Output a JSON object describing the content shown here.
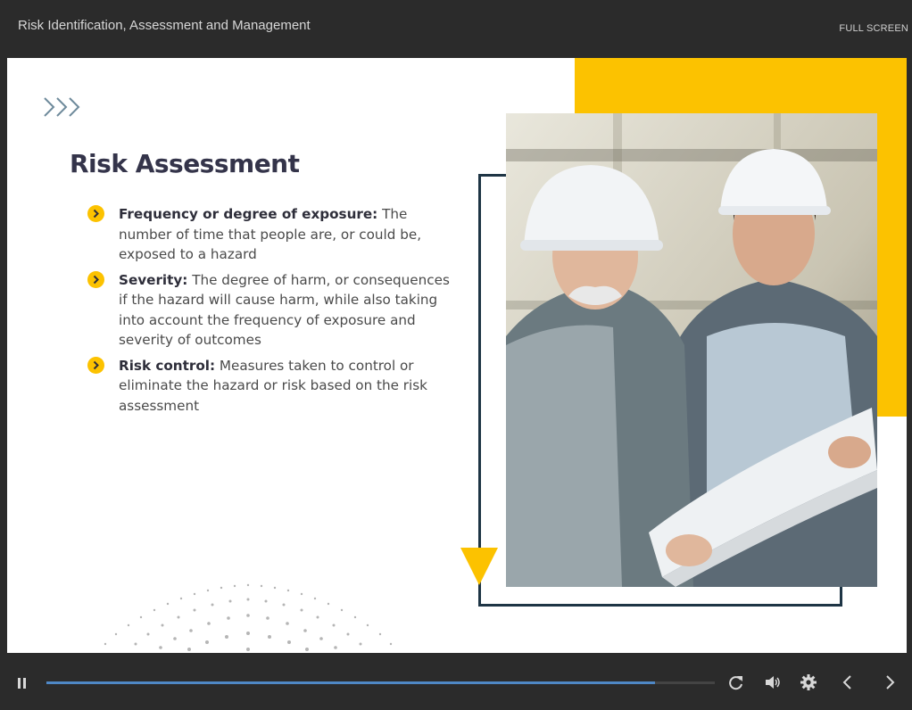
{
  "header": {
    "course_title": "Risk Identification, Assessment and Management",
    "fullscreen_label": "FULL SCREEN"
  },
  "slide": {
    "heading": "Risk Assessment",
    "bullets": [
      {
        "term": "Frequency or degree of exposure:",
        "text": " The number of time that people are, or could be, exposed to a hazard"
      },
      {
        "term": "Severity:",
        "text": " The degree of harm, or consequences if the hazard will cause harm, while also taking into account the frequency of exposure and severity of outcomes"
      },
      {
        "term": "Risk control:",
        "text": " Measures taken to control or eliminate the hazard or risk based on the risk assessment"
      }
    ],
    "photo_description_icon": "workers-hardhats-photo"
  },
  "player": {
    "progress": 0.91,
    "icons": [
      "pause-icon",
      "replay-icon",
      "volume-icon",
      "settings-icon",
      "prev-icon",
      "next-icon"
    ]
  },
  "colors": {
    "accent_yellow": "#fcc200",
    "frame_navy": "#1e3545",
    "progress_blue": "#4f88c6",
    "chrome_dark": "#2b2b2b"
  }
}
